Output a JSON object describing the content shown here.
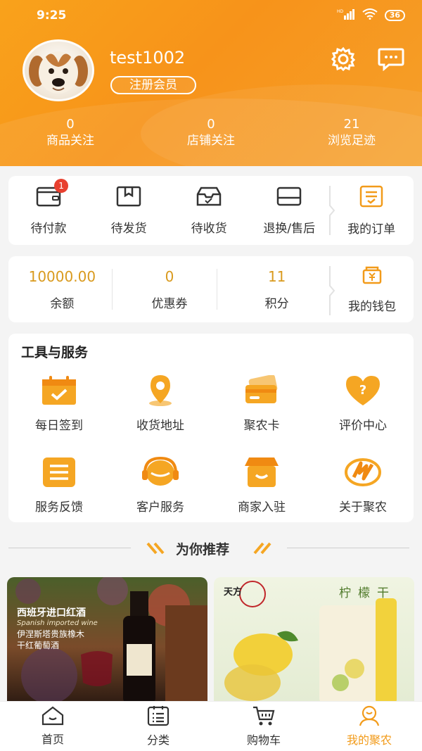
{
  "status": {
    "time": "9:25",
    "battery": "36",
    "network": "HD"
  },
  "profile": {
    "username": "test1002",
    "member_label": "注册会员"
  },
  "stats": [
    {
      "num": "0",
      "label": "商品关注"
    },
    {
      "num": "0",
      "label": "店铺关注"
    },
    {
      "num": "21",
      "label": "浏览足迹"
    }
  ],
  "orders": {
    "items": [
      {
        "label": "待付款",
        "icon": "wallet-icon",
        "badge": "1"
      },
      {
        "label": "待发货",
        "icon": "box-icon"
      },
      {
        "label": "待收货",
        "icon": "receive-icon"
      },
      {
        "label": "退换/售后",
        "icon": "return-icon"
      }
    ],
    "my_orders": "我的订单"
  },
  "wallet": {
    "balance": {
      "num": "10000.00",
      "label": "余额"
    },
    "coupons": {
      "num": "0",
      "label": "优惠券"
    },
    "points": {
      "num": "11",
      "label": "积分"
    },
    "my_wallet": "我的钱包"
  },
  "tools": {
    "title": "工具与服务",
    "items": [
      {
        "label": "每日签到",
        "icon": "calendar-check-icon"
      },
      {
        "label": "收货地址",
        "icon": "location-pin-icon"
      },
      {
        "label": "聚农卡",
        "icon": "card-icon"
      },
      {
        "label": "评价中心",
        "icon": "heart-question-icon"
      },
      {
        "label": "服务反馈",
        "icon": "list-icon"
      },
      {
        "label": "客户服务",
        "icon": "headset-icon"
      },
      {
        "label": "商家入驻",
        "icon": "store-icon"
      },
      {
        "label": "关于聚农",
        "icon": "logo-icon"
      }
    ]
  },
  "recommend": {
    "title": "为你推荐"
  },
  "products": [
    {
      "title": "西班牙进口红酒",
      "subtitle_en": "Spanish imported wine",
      "line1": "伊涅斯塔贵族橡木",
      "line2": "干红葡萄酒"
    },
    {
      "title": "柠檬干",
      "brand": "天方"
    }
  ],
  "tabbar": [
    {
      "label": "首页",
      "icon": "home-icon"
    },
    {
      "label": "分类",
      "icon": "category-icon"
    },
    {
      "label": "购物车",
      "icon": "cart-icon"
    },
    {
      "label": "我的聚农",
      "icon": "profile-icon",
      "active": true
    }
  ],
  "colors": {
    "accent": "#f29b1a",
    "badge": "#e8402f",
    "header": "#f7931a"
  }
}
